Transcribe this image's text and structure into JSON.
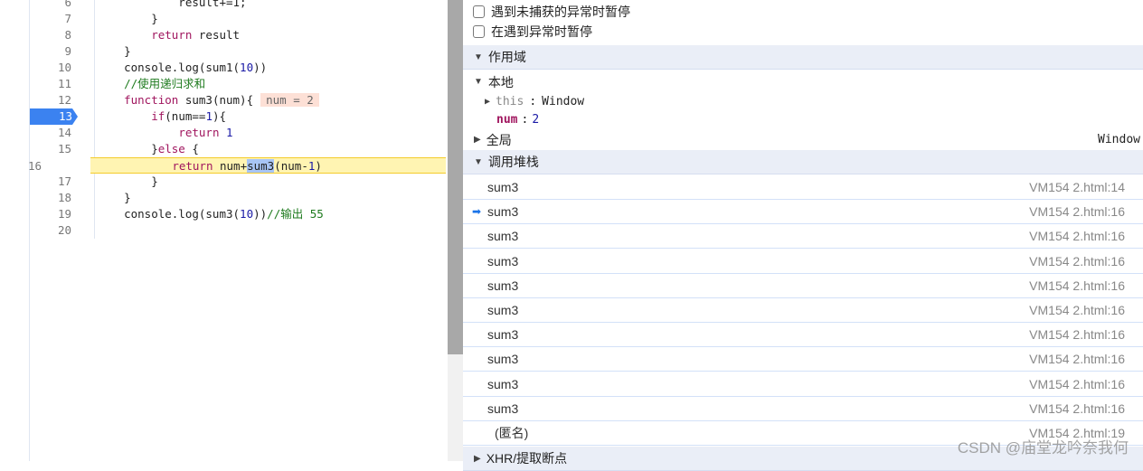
{
  "editor": {
    "breakpoint_line": 13,
    "paused_line": 16,
    "lines": [
      {
        "n": "6",
        "tokens": [
          [
            "            result+=1;",
            ""
          ]
        ]
      },
      {
        "n": "7",
        "tokens": [
          [
            "        }",
            ""
          ]
        ]
      },
      {
        "n": "8",
        "tokens": [
          [
            "        ",
            ""
          ],
          [
            "return",
            "kw"
          ],
          [
            " result",
            ""
          ]
        ]
      },
      {
        "n": "9",
        "tokens": [
          [
            "    }",
            ""
          ]
        ]
      },
      {
        "n": "10",
        "tokens": [
          [
            "    console.log(sum1(",
            ""
          ],
          [
            "10",
            "num"
          ],
          [
            "))",
            ""
          ]
        ]
      },
      {
        "n": "11",
        "tokens": [
          [
            "    //使用递归求和",
            "cm"
          ]
        ]
      },
      {
        "n": "12",
        "tokens": [
          [
            "    ",
            ""
          ],
          [
            "function",
            "kw"
          ],
          [
            " sum3(num){",
            ""
          ]
        ],
        "inline_value": "num = 2"
      },
      {
        "n": "13",
        "tokens": [
          [
            "        ",
            ""
          ],
          [
            "if",
            "kw"
          ],
          [
            "(num==",
            ""
          ],
          [
            "1",
            "num"
          ],
          [
            "){",
            ""
          ]
        ]
      },
      {
        "n": "14",
        "tokens": [
          [
            "            ",
            ""
          ],
          [
            "return",
            "kw"
          ],
          [
            " ",
            ""
          ],
          [
            "1",
            "num"
          ]
        ]
      },
      {
        "n": "15",
        "tokens": [
          [
            "        }",
            ""
          ],
          [
            "else",
            "kw"
          ],
          [
            " {",
            ""
          ]
        ]
      },
      {
        "n": "16",
        "tokens": [
          [
            "            ",
            ""
          ],
          [
            "return",
            "kw"
          ],
          [
            " num+",
            ""
          ],
          [
            "sum3",
            "hl"
          ],
          [
            "(num-",
            ""
          ],
          [
            "1",
            "num"
          ],
          [
            ")",
            ""
          ]
        ]
      },
      {
        "n": "17",
        "tokens": [
          [
            "        }",
            ""
          ]
        ]
      },
      {
        "n": "18",
        "tokens": [
          [
            "    }",
            ""
          ]
        ]
      },
      {
        "n": "19",
        "tokens": [
          [
            "    console.log(sum3(",
            ""
          ],
          [
            "10",
            "num"
          ],
          [
            "))",
            ""
          ],
          [
            "//输出 55",
            "cm"
          ]
        ]
      },
      {
        "n": "20",
        "tokens": []
      }
    ]
  },
  "panel": {
    "pause_uncaught": {
      "label": "遇到未捕获的异常时暂停",
      "checked": false
    },
    "pause_caught": {
      "label": "在遇到异常时暂停",
      "checked": false
    },
    "scope": {
      "title": "作用域",
      "local_title": "本地",
      "this_key": "this",
      "this_value": "Window",
      "num_key": "num",
      "num_value": "2",
      "global_title": "全局",
      "global_value": "Window"
    },
    "callstack": {
      "title": "调用堆栈",
      "frames": [
        {
          "fn": "sum3",
          "loc": "VM154 2.html:14",
          "current": false
        },
        {
          "fn": "sum3",
          "loc": "VM154 2.html:16",
          "current": true
        },
        {
          "fn": "sum3",
          "loc": "VM154 2.html:16",
          "current": false
        },
        {
          "fn": "sum3",
          "loc": "VM154 2.html:16",
          "current": false
        },
        {
          "fn": "sum3",
          "loc": "VM154 2.html:16",
          "current": false
        },
        {
          "fn": "sum3",
          "loc": "VM154 2.html:16",
          "current": false
        },
        {
          "fn": "sum3",
          "loc": "VM154 2.html:16",
          "current": false
        },
        {
          "fn": "sum3",
          "loc": "VM154 2.html:16",
          "current": false
        },
        {
          "fn": "sum3",
          "loc": "VM154 2.html:16",
          "current": false
        },
        {
          "fn": "sum3",
          "loc": "VM154 2.html:16",
          "current": false
        },
        {
          "fn": "(匿名)",
          "loc": "VM154 2.html:19",
          "current": false
        }
      ]
    },
    "xhr_title": "XHR/提取断点"
  },
  "watermark": "CSDN @庙堂龙吟奈我何"
}
